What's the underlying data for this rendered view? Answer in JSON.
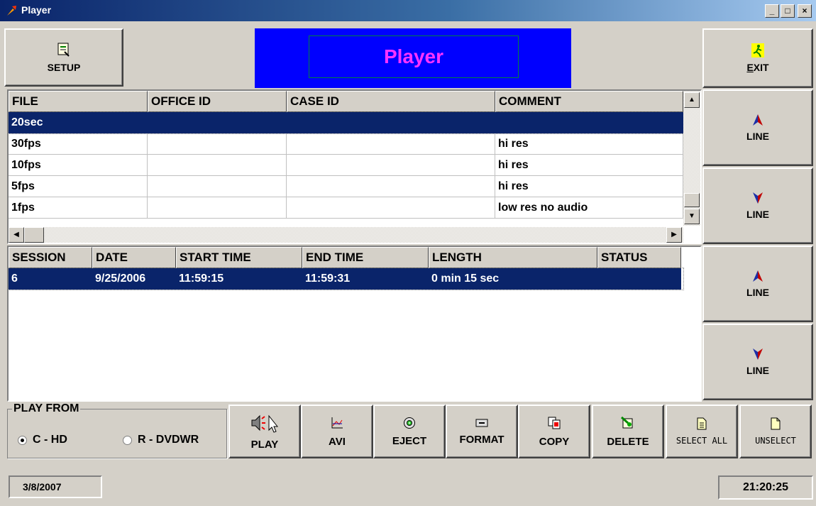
{
  "window": {
    "title": "Player",
    "min": "_",
    "max": "□",
    "close": "×"
  },
  "header": {
    "setup_label": "SETUP",
    "banner_title": "Player",
    "exit_label": "EXIT"
  },
  "file_table": {
    "columns": [
      "FILE",
      "OFFICE ID",
      "CASE ID",
      "COMMENT"
    ],
    "rows": [
      [
        "20sec",
        "",
        "",
        ""
      ],
      [
        "30fps",
        "",
        "",
        "hi res"
      ],
      [
        "10fps",
        "",
        "",
        "hi res"
      ],
      [
        "5fps",
        "",
        "",
        "hi res"
      ],
      [
        "1fps",
        "",
        "",
        "low res no audio"
      ]
    ],
    "selected_row": 0
  },
  "line_buttons": [
    {
      "label": "LINE",
      "direction": "up"
    },
    {
      "label": "LINE",
      "direction": "down"
    },
    {
      "label": "LINE",
      "direction": "up"
    },
    {
      "label": "LINE",
      "direction": "down"
    }
  ],
  "session_table": {
    "columns": [
      "SESSION",
      "DATE",
      "START TIME",
      "END TIME",
      "LENGTH",
      "STATUS"
    ],
    "rows": [
      [
        "6",
        "9/25/2006",
        "11:59:15",
        "11:59:31",
        "0 min 15 sec",
        ""
      ]
    ],
    "selected_row": 0
  },
  "play_from": {
    "legend": "PLAY FROM",
    "options": [
      {
        "label": "C - HD",
        "checked": true
      },
      {
        "label": "R - DVDWR",
        "checked": false
      }
    ]
  },
  "actions": {
    "play": "PLAY",
    "avi": "AVI",
    "eject": "EJECT",
    "format": "FORMAT",
    "copy": "COPY",
    "delete": "DELETE",
    "select_all": "SELECT ALL",
    "unselect": "UNSELECT"
  },
  "status": {
    "date": "3/8/2007",
    "time": "21:20:25"
  },
  "colors": {
    "selection": "#0a246a",
    "banner_bg": "#0000ff",
    "banner_text": "#ff33ff",
    "face": "#d4d0c8"
  }
}
